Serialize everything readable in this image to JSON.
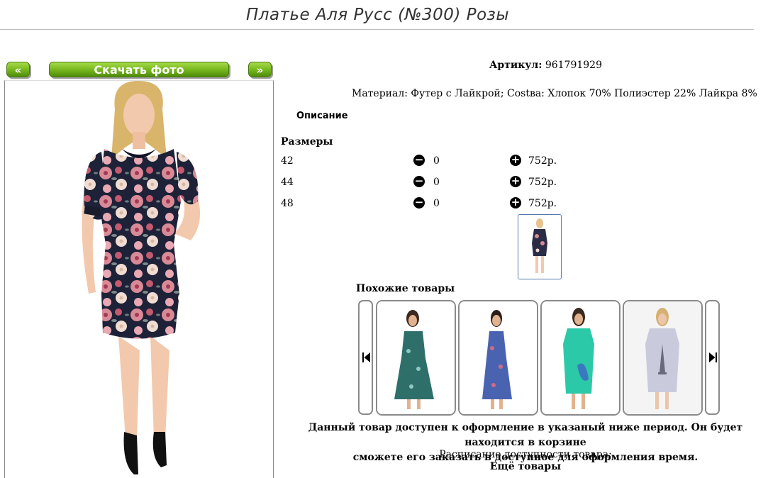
{
  "page": {
    "title": "Платье Аля Русс (№300) Розы"
  },
  "photo_nav": {
    "prev_label": "«",
    "download_label": "Скачать фото",
    "next_label": "»"
  },
  "product": {
    "sku_label": "Артикул:",
    "sku_value": "961791929",
    "material": "Материал: Футер с Лайкрой; Сostва: Хлопок 70% Полиэстер 22% Лайкра 8%",
    "description_heading": "Описание",
    "sizes_heading": "Размеры",
    "sizes": [
      {
        "size": "42",
        "qty": "0",
        "price": "752р."
      },
      {
        "size": "44",
        "qty": "0",
        "price": "752р."
      },
      {
        "size": "48",
        "qty": "0",
        "price": "752р."
      }
    ]
  },
  "similar": {
    "heading": "Похожие товары",
    "items": [
      {
        "name": "dress-teal-print",
        "color": "#2f6f6a"
      },
      {
        "name": "dress-blue-floral",
        "color": "#4a63b0"
      },
      {
        "name": "dress-turquoise",
        "color": "#2cc9a8"
      },
      {
        "name": "dress-grey-eiffel",
        "color": "#c9cbdd"
      }
    ]
  },
  "notice": {
    "line1": "Данный товар доступен к оформление в указаный ниже период. Он будет находится в корзине",
    "line2": "сможете его заказать в доступное для оформления время.",
    "schedule": "Расписание доступности товара:",
    "schedule_sub": "Ещё товары"
  },
  "icons": {
    "prev": "chevron-double-left-icon",
    "next": "chevron-double-right-icon",
    "minus": "minus-circle-icon",
    "plus": "plus-circle-icon",
    "carousel_prev": "skip-back-icon",
    "carousel_next": "skip-forward-icon"
  }
}
